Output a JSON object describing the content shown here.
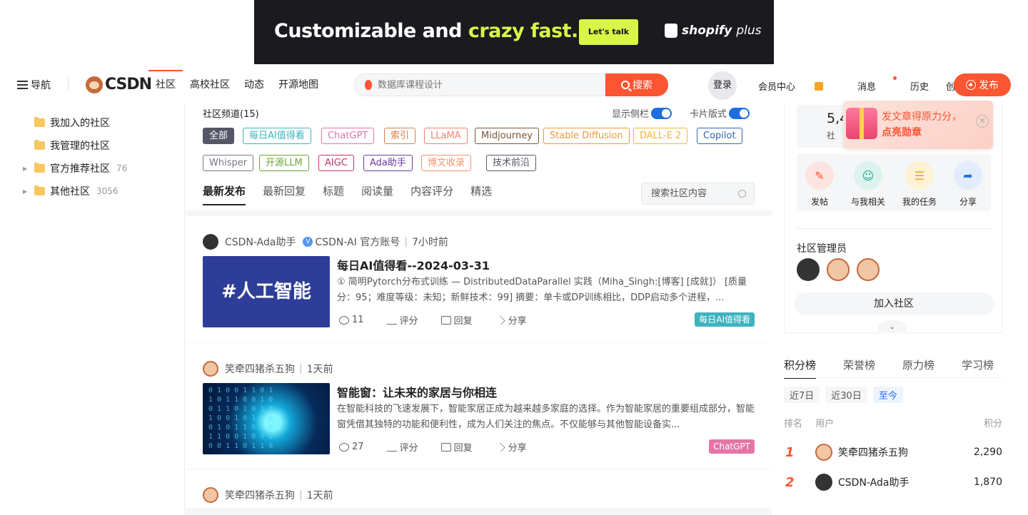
{
  "ad": {
    "headline_plain": "Customizable and ",
    "headline_highlight": "crazy fast.",
    "cta": "Let's talk",
    "brand": "shopify",
    "brand_suffix": "plus"
  },
  "header": {
    "menu_label": "导航",
    "logo_text": "CSDN",
    "nav": [
      "社区",
      "高校社区",
      "动态",
      "开源地图"
    ],
    "search_placeholder": "数据库课程设计",
    "search_button": "搜索",
    "login": "登录",
    "right_nav": [
      "会员中心",
      "消息",
      "历史",
      "创作中心"
    ],
    "publish": "发布"
  },
  "sidebar": {
    "items": [
      {
        "label": "我加入的社区",
        "count": ""
      },
      {
        "label": "我管理的社区",
        "count": ""
      },
      {
        "label": "官方推荐社区",
        "count": "76"
      },
      {
        "label": "其他社区",
        "count": "3056"
      }
    ]
  },
  "channels": {
    "title": "社区频道(15)",
    "toggle_sidebar": "显示侧栏",
    "toggle_card": "卡片版式",
    "tags": [
      {
        "label": "全部",
        "color": "#555666"
      },
      {
        "label": "每日AI值得看",
        "color": "#3eb3bd"
      },
      {
        "label": "ChatGPT",
        "color": "#e575a6"
      },
      {
        "label": "索引",
        "color": "#d97f47"
      },
      {
        "label": "LLaMA",
        "color": "#f3826f"
      },
      {
        "label": "Midjourney",
        "color": "#7a5535"
      },
      {
        "label": "Stable Diffusion",
        "color": "#ef9a2f"
      },
      {
        "label": "DALL-E 2",
        "color": "#f0b43c"
      },
      {
        "label": "Copilot",
        "color": "#2f67b1"
      },
      {
        "label": "Whisper",
        "color": "#777888"
      },
      {
        "label": "开源LLM",
        "color": "#6ca638"
      },
      {
        "label": "AIGC",
        "color": "#c6306e"
      },
      {
        "label": "Ada助手",
        "color": "#6a3a9f"
      },
      {
        "label": "博文收录",
        "color": "#f4966d"
      },
      {
        "label": "技术前沿",
        "color": "#555666"
      }
    ],
    "tabs": [
      "最新发布",
      "最新回复",
      "标题",
      "阅读量",
      "内容评分",
      "精选"
    ],
    "search_placeholder": "搜索社区内容"
  },
  "posts": [
    {
      "author": "CSDN-Ada助手",
      "org": "CSDN-AI 官方账号",
      "time": "7小时前",
      "thumb_text": "#人工智能",
      "title": "每日AI值得看--2024-03-31",
      "summary": "① 简明Pytorch分布式训练 — DistributedDataParallel 实践（Miha_Singh:[博客] [成就]） [质量分：95；难度等级：未知；新鲜技术：99] 摘要：单卡或DP训练相比，DDP启动多个进程，...",
      "views": "11",
      "rate": "评分",
      "reply": "回复",
      "share": "分享",
      "tag": "每日AI值得看",
      "tag_color": "#3eb3bd"
    },
    {
      "author": "笑牵四猪杀五狗",
      "org": "",
      "time": "1天前",
      "thumb_text": "",
      "title": "智能窗：让未来的家居与你相连",
      "summary": "在智能科技的飞速发展下，智能家居正成为越来越多家庭的选择。作为智能家居的重要组成部分，智能窗凭借其独特的功能和便利性，成为人们关注的焦点。不仅能够与其他智能设备实...",
      "views": "27",
      "rate": "评分",
      "reply": "回复",
      "share": "分享",
      "tag": "ChatGPT",
      "tag_color": "#e575a6"
    },
    {
      "author": "笑牵四猪杀五狗",
      "time": "1天前"
    }
  ],
  "right": {
    "stat_number": "5,4",
    "stat_label": "社",
    "promo_line1": "发文章得原力分，",
    "promo_line2": "点亮勋章",
    "actions": [
      {
        "label": "发帖",
        "icon": "edit-icon",
        "color": "#fde4e0"
      },
      {
        "label": "与我相关",
        "icon": "users-icon",
        "color": "#dcf3ee"
      },
      {
        "label": "我的任务",
        "icon": "task-icon",
        "color": "#fdf1d6"
      },
      {
        "label": "分享",
        "icon": "share-icon",
        "color": "#e3ecfd"
      }
    ],
    "admins_title": "社区管理员",
    "join": "加入社区",
    "rank_tabs": [
      "积分榜",
      "荣誉榜",
      "原力榜",
      "学习榜"
    ],
    "periods": [
      "近7日",
      "近30日",
      "至今"
    ],
    "rank_head": {
      "no": "排名",
      "user": "用户",
      "score": "积分"
    },
    "ranks": [
      {
        "no": "1",
        "name": "笑牵四猪杀五狗",
        "score": "2,290"
      },
      {
        "no": "2",
        "name": "CSDN-Ada助手",
        "score": "1,870"
      }
    ]
  }
}
